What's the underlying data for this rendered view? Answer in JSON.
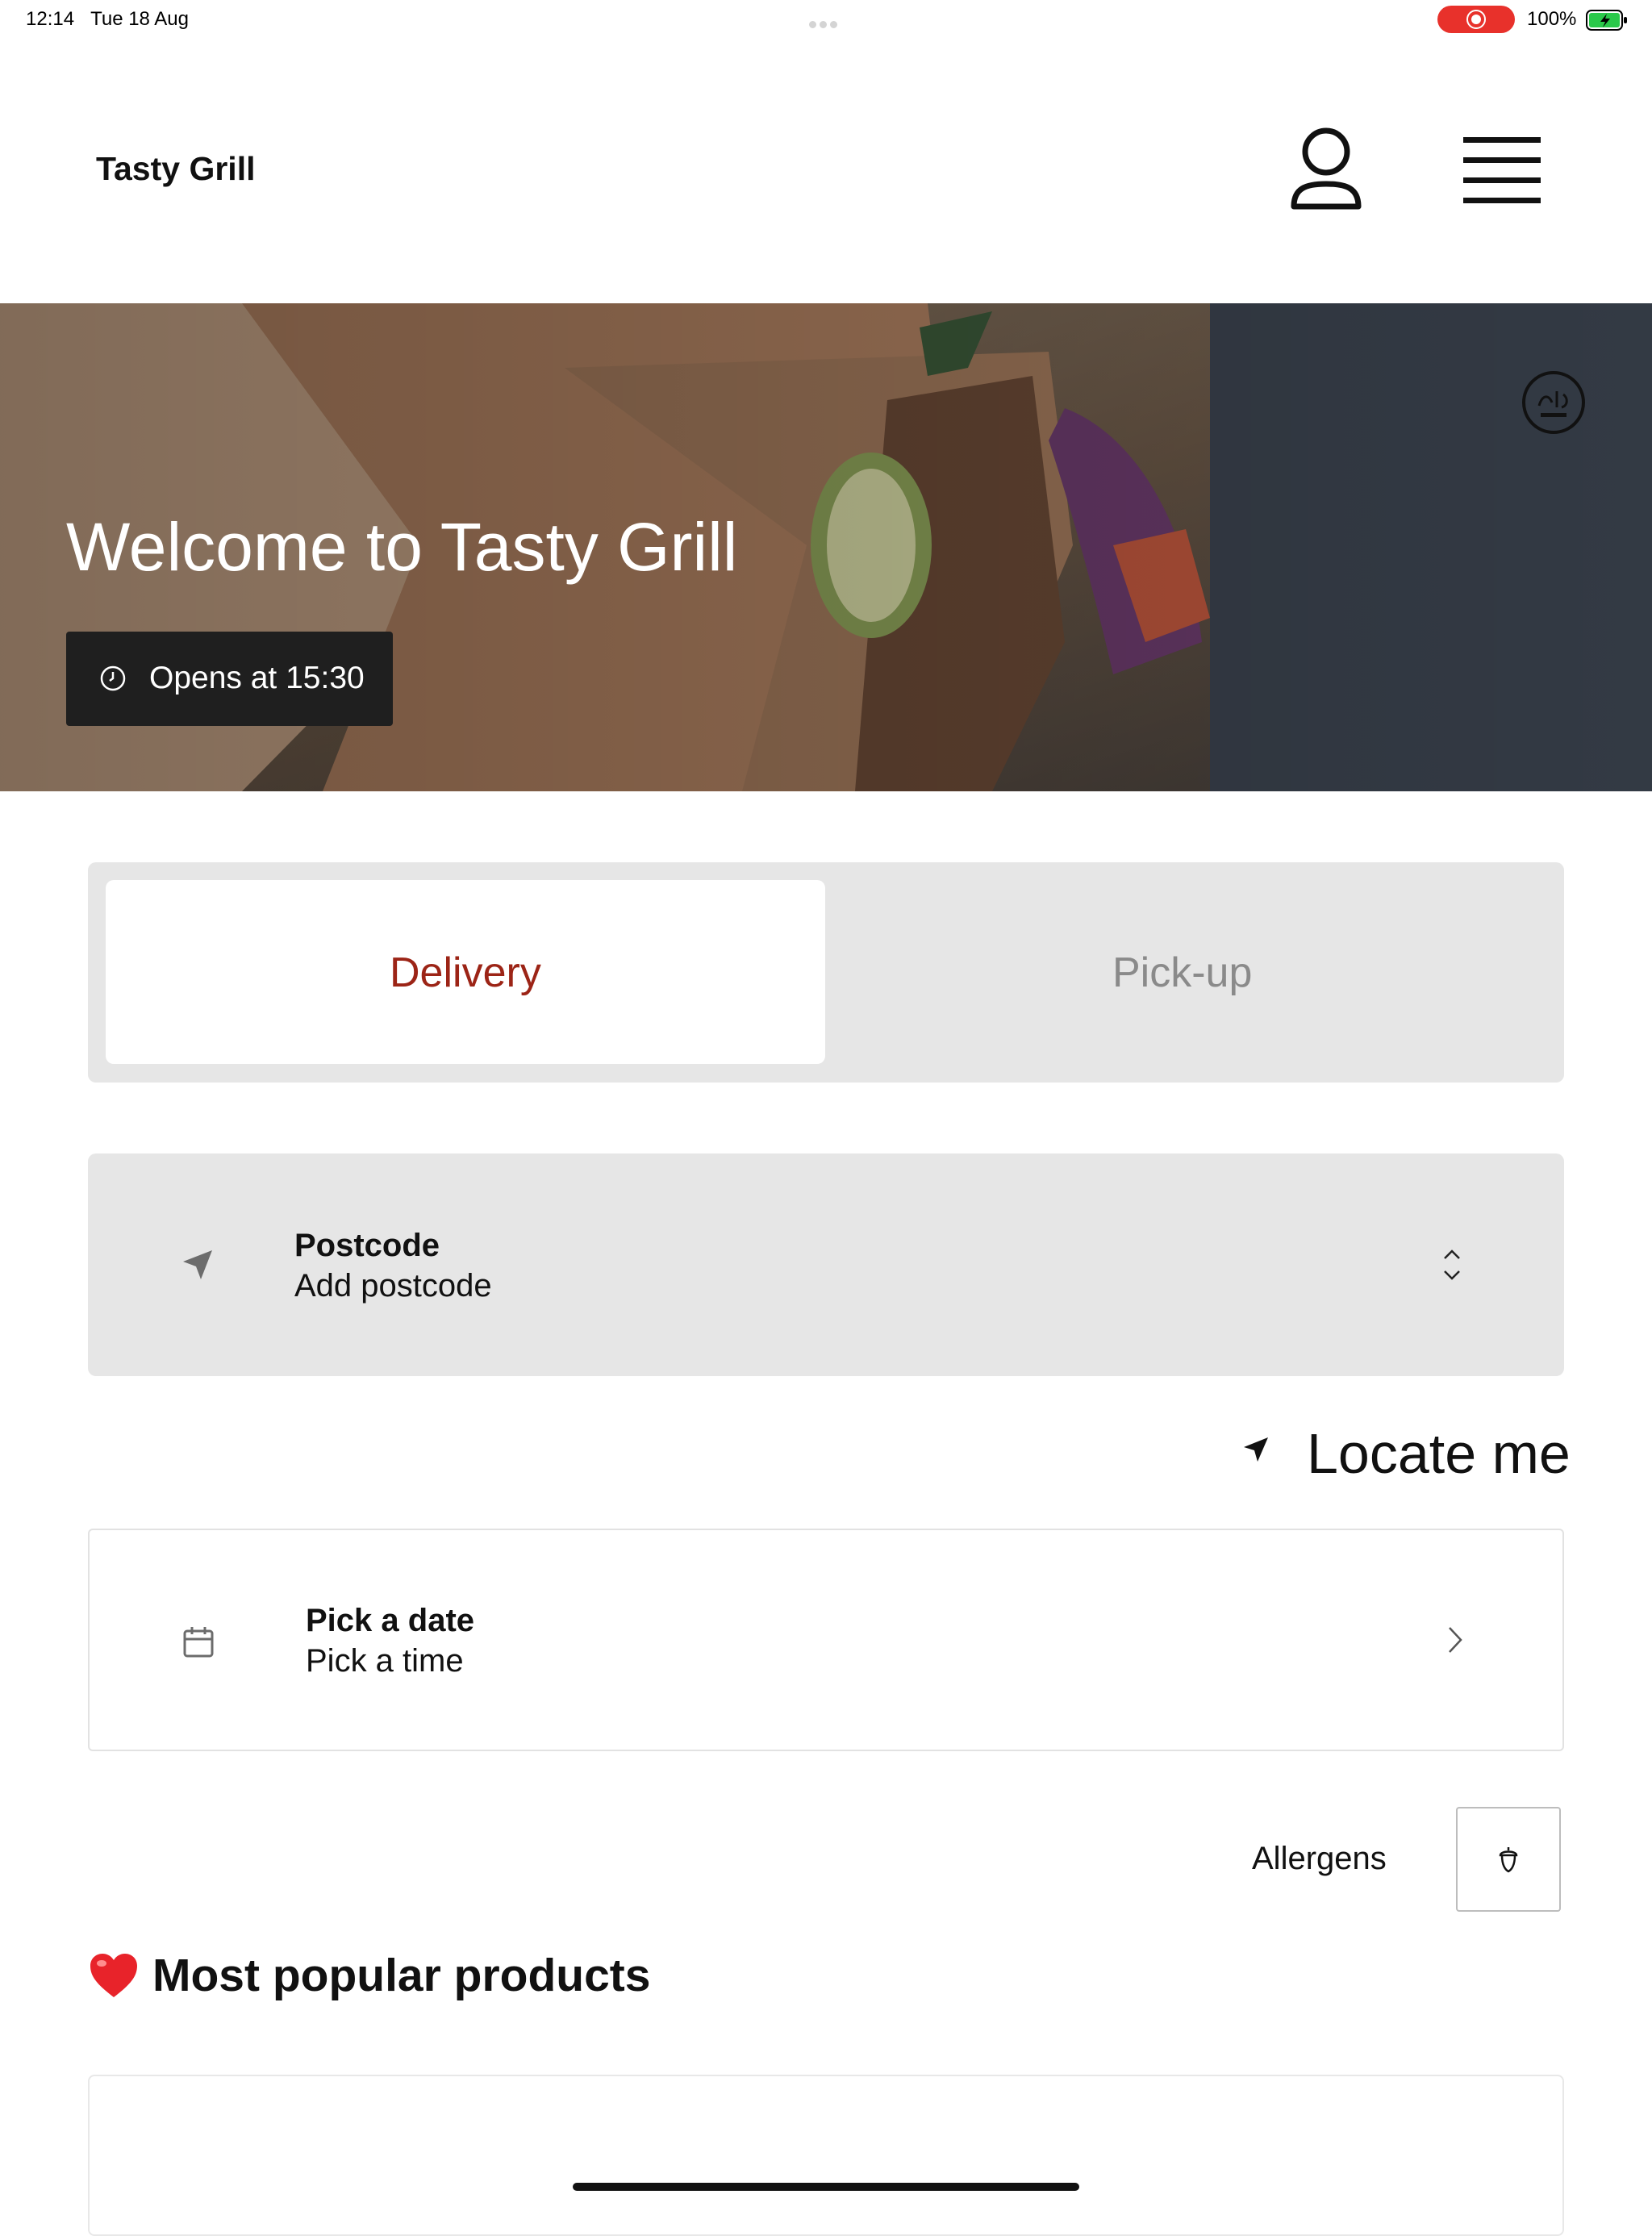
{
  "status_bar": {
    "time": "12:14",
    "date": "Tue 18 Aug",
    "battery": "100%",
    "recording_color": "#e8312b",
    "battery_icon": "battery-charging-icon"
  },
  "header": {
    "brand": "Tasty Grill",
    "account_icon": "user-icon",
    "menu_icon": "hamburger-menu-icon"
  },
  "hero": {
    "title": "Welcome to Tasty Grill",
    "hours": "Opens at 15:30",
    "hours_icon": "clock-icon",
    "badge_icon": "halal-badge-icon"
  },
  "order_mode": {
    "options": [
      "Delivery",
      "Pick-up"
    ],
    "selected": "Delivery",
    "accent_color": "#9c2416"
  },
  "postcode": {
    "label": "Postcode",
    "placeholder": "Add postcode",
    "icon": "location-arrow-icon"
  },
  "locate": {
    "label": "Locate me",
    "icon": "location-arrow-icon"
  },
  "schedule": {
    "date_label": "Pick a date",
    "time_label": "Pick a time",
    "icon": "calendar-icon"
  },
  "allergens": {
    "label": "Allergens",
    "icon": "acorn-icon"
  },
  "popular": {
    "icon": "heart-icon",
    "title": "Most popular products"
  }
}
